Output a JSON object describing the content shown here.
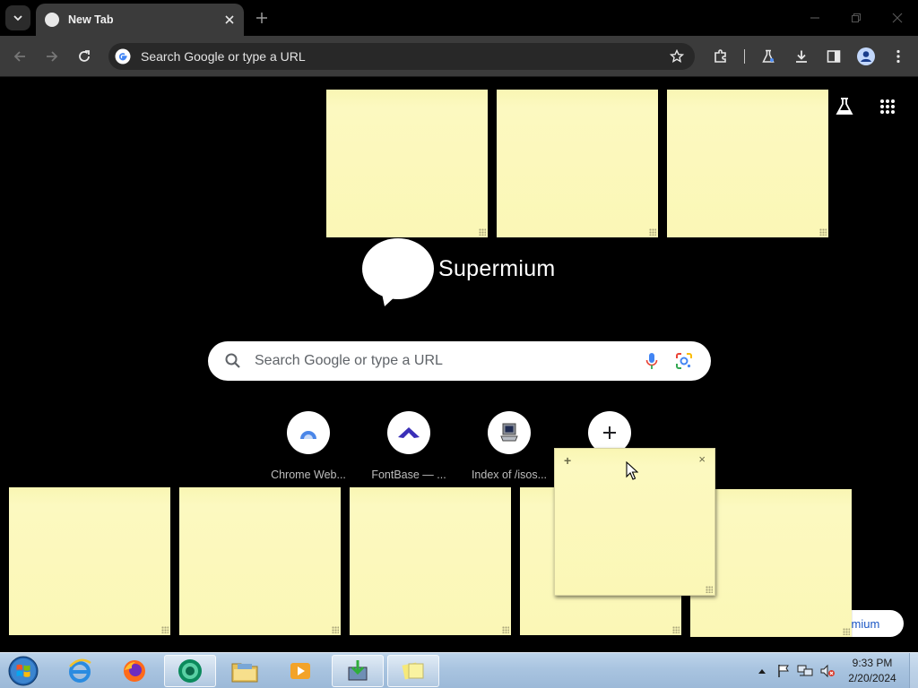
{
  "browser": {
    "tab": {
      "title": "New Tab"
    },
    "omnibox": {
      "text": "Search Google or type a URL"
    }
  },
  "ntp": {
    "logo_text": "Supermium",
    "realbox": {
      "placeholder": "Search Google or type a URL"
    },
    "shortcuts": [
      {
        "label": "Chrome Web..."
      },
      {
        "label": "FontBase — ..."
      },
      {
        "label": "Index of /isos..."
      }
    ],
    "customize_label": "ermium"
  },
  "sticky_notes": {
    "active_add": "+",
    "active_close": "×"
  },
  "taskbar": {
    "clock_time": "9:33 PM",
    "clock_date": "2/20/2024"
  },
  "colors": {
    "sticky_yellow": "#fbf7b6",
    "toolbar_gray": "#3b3b3b",
    "taskbar_blue": "#a9c4e0"
  }
}
